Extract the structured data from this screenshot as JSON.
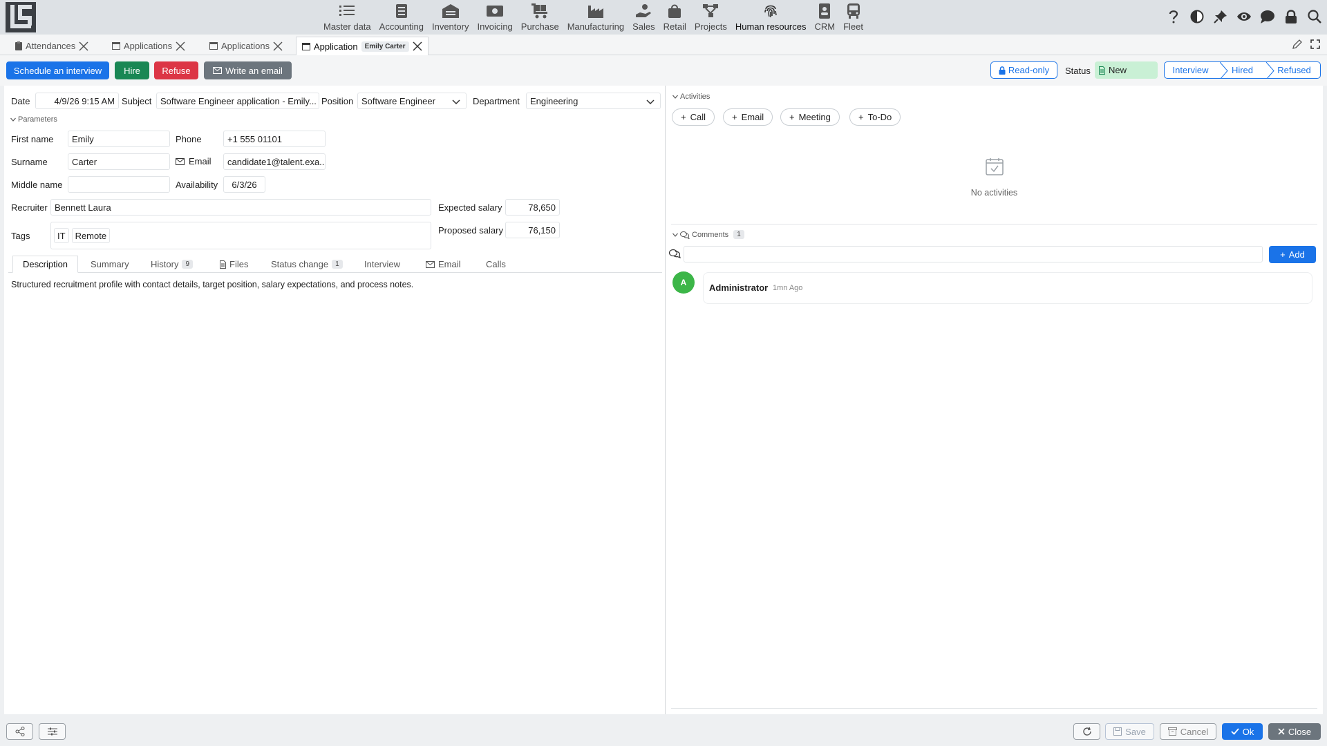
{
  "nav": {
    "modules": [
      {
        "label": "Master data",
        "icon": "list-check-icon"
      },
      {
        "label": "Accounting",
        "icon": "ledger-icon"
      },
      {
        "label": "Inventory",
        "icon": "warehouse-icon"
      },
      {
        "label": "Invoicing",
        "icon": "cash-icon"
      },
      {
        "label": "Purchase",
        "icon": "cart-icon"
      },
      {
        "label": "Manufacturing",
        "icon": "factory-icon"
      },
      {
        "label": "Sales",
        "icon": "hand-coin-icon"
      },
      {
        "label": "Retail",
        "icon": "shopping-bag-icon"
      },
      {
        "label": "Projects",
        "icon": "diagram-icon"
      },
      {
        "label": "Human resources",
        "icon": "fingerprint-icon"
      },
      {
        "label": "CRM",
        "icon": "contact-card-icon"
      },
      {
        "label": "Fleet",
        "icon": "bus-icon"
      }
    ],
    "active_module": "Human resources",
    "tool_icons": [
      "help-icon",
      "contrast-icon",
      "pin-icon",
      "eye-icon",
      "chat-icon",
      "lock-icon",
      "search-icon"
    ]
  },
  "tabs": [
    {
      "label": "Attendances",
      "icon": "clipboard-icon"
    },
    {
      "label": "Applications",
      "icon": "window-icon"
    },
    {
      "label": "Applications",
      "icon": "window-icon"
    },
    {
      "label": "Application",
      "icon": "window-icon",
      "badge": "Emily Carter",
      "active": true
    }
  ],
  "actions": {
    "schedule": "Schedule an interview",
    "hire": "Hire",
    "refuse": "Refuse",
    "email": "Write an email",
    "readonly": "Read-only",
    "status_label": "Status",
    "status_value": "New",
    "stages": [
      "Interview",
      "Hired",
      "Refused"
    ]
  },
  "form": {
    "date_label": "Date",
    "date_value": "4/9/26 9:15 AM",
    "subject_label": "Subject",
    "subject_value": "Software Engineer application - Emily...",
    "position_label": "Position",
    "position_value": "Software Engineer",
    "department_label": "Department",
    "department_value": "Engineering",
    "parameters_label": "Parameters",
    "first_name_label": "First name",
    "first_name_value": "Emily",
    "phone_label": "Phone",
    "phone_value": "+1 555 01101",
    "surname_label": "Surname",
    "surname_value": "Carter",
    "email_label": "Email",
    "email_value": "candidate1@talent.exa...",
    "middle_name_label": "Middle name",
    "middle_name_value": "",
    "availability_label": "Availability",
    "availability_value": "6/3/26",
    "recruiter_label": "Recruiter",
    "recruiter_value": "Bennett Laura",
    "expected_salary_label": "Expected salary",
    "expected_salary_value": "78,650",
    "tags_label": "Tags",
    "tags": [
      "IT",
      "Remote"
    ],
    "proposed_salary_label": "Proposed salary",
    "proposed_salary_value": "76,150"
  },
  "detail_tabs": [
    {
      "label": "Description",
      "active": true
    },
    {
      "label": "Summary"
    },
    {
      "label": "History",
      "count": "9"
    },
    {
      "label": "Files",
      "icon": "file-icon"
    },
    {
      "label": "Status change",
      "count": "1"
    },
    {
      "label": "Interview"
    },
    {
      "label": "Email",
      "icon": "envelope-icon"
    },
    {
      "label": "Calls"
    }
  ],
  "description_text": "Structured recruitment profile with contact details, target position, salary expectations, and process notes.",
  "activities": {
    "label": "Activities",
    "buttons": [
      "Call",
      "Email",
      "Meeting",
      "To-Do"
    ],
    "empty_text": "No activities"
  },
  "comments": {
    "label": "Comments",
    "count": "1",
    "input_placeholder": "",
    "add_label": "Add",
    "items": [
      {
        "avatar": "A",
        "author": "Administrator",
        "time": "1mn Ago"
      }
    ]
  },
  "footer": {
    "save": "Save",
    "cancel": "Cancel",
    "ok": "Ok",
    "close": "Close"
  },
  "colors": {
    "primary": "#1a73e8",
    "success": "#198754",
    "danger": "#dc3545",
    "secondary": "#6c757d",
    "status_new_bg": "#c9f0d5",
    "avatar": "#3cb648"
  }
}
